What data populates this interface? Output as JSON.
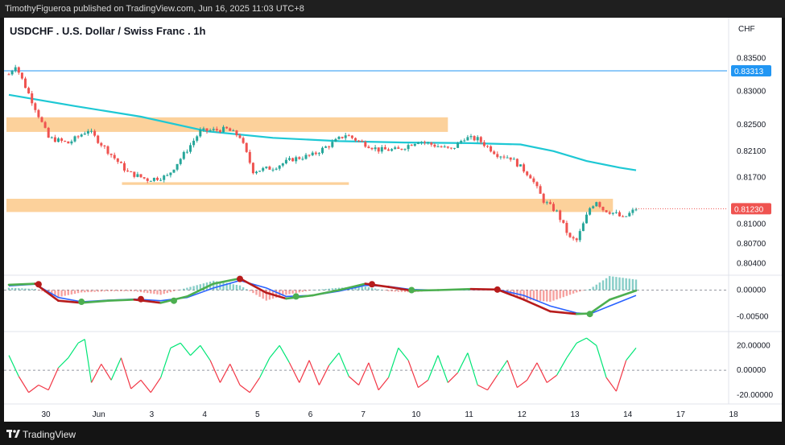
{
  "header": {
    "published_by": "TimothyFigueroa published on TradingView.com, Jun 16, 2025 11:03 UTC+8"
  },
  "chart": {
    "title": "USDCHF . U.S. Dollar / Swiss Franc . 1h",
    "currency": "CHF"
  },
  "footer": {
    "brand": "TradingView"
  },
  "colors": {
    "bull": "#26a69a",
    "bear": "#ef5350",
    "ma": "#1ec8d4",
    "zone": "#fbc98a",
    "hline": "#2196f3",
    "green": "#4caf50",
    "red": "#b71c1c",
    "blue": "#2962ff",
    "rsi_up": "#00e676",
    "rsi_down": "#f23645"
  },
  "chart_data": [
    {
      "type": "candlestick",
      "title": "USDCHF . U.S. Dollar / Swiss Franc . 1h",
      "x_ticks": [
        "30",
        "Jun",
        "3",
        "4",
        "5",
        "6",
        "7",
        "10",
        "11",
        "12",
        "13",
        "14",
        "17",
        "18"
      ],
      "y_ticks": [
        "0.83500",
        "0.83000",
        "0.82500",
        "0.82100",
        "0.81700",
        "0.81230",
        "0.81000",
        "0.80700",
        "0.80400"
      ],
      "ylim": [
        0.8025,
        0.8375
      ],
      "current_price_label": "0.81230",
      "horizontal_line_label": "0.83313",
      "horizontal_line": 0.83313,
      "zones": [
        {
          "from_bar": 0,
          "to_bar": 133,
          "low": 0.8239,
          "high": 0.8261
        },
        {
          "from_bar": 35,
          "to_bar": 103,
          "low": 0.8159,
          "high": 0.8163
        },
        {
          "from_bar": 0,
          "to_bar": 183,
          "low": 0.8118,
          "high": 0.8138
        }
      ],
      "key_closes": [
        {
          "bar": 0,
          "close": 0.8326
        },
        {
          "bar": 2,
          "close": 0.834
        },
        {
          "bar": 8,
          "close": 0.8275
        },
        {
          "bar": 12,
          "close": 0.823
        },
        {
          "bar": 18,
          "close": 0.8222
        },
        {
          "bar": 24,
          "close": 0.8242
        },
        {
          "bar": 30,
          "close": 0.821
        },
        {
          "bar": 36,
          "close": 0.8178
        },
        {
          "bar": 42,
          "close": 0.8167
        },
        {
          "bar": 48,
          "close": 0.8172
        },
        {
          "bar": 54,
          "close": 0.8212
        },
        {
          "bar": 58,
          "close": 0.824
        },
        {
          "bar": 66,
          "close": 0.8243
        },
        {
          "bar": 70,
          "close": 0.8232
        },
        {
          "bar": 74,
          "close": 0.818
        },
        {
          "bar": 80,
          "close": 0.8185
        },
        {
          "bar": 86,
          "close": 0.8198
        },
        {
          "bar": 92,
          "close": 0.8204
        },
        {
          "bar": 98,
          "close": 0.8222
        },
        {
          "bar": 102,
          "close": 0.8235
        },
        {
          "bar": 106,
          "close": 0.8225
        },
        {
          "bar": 112,
          "close": 0.8212
        },
        {
          "bar": 118,
          "close": 0.8212
        },
        {
          "bar": 124,
          "close": 0.8226
        },
        {
          "bar": 128,
          "close": 0.822
        },
        {
          "bar": 134,
          "close": 0.8212
        },
        {
          "bar": 138,
          "close": 0.823
        },
        {
          "bar": 142,
          "close": 0.8228
        },
        {
          "bar": 148,
          "close": 0.8205
        },
        {
          "bar": 152,
          "close": 0.82
        },
        {
          "bar": 158,
          "close": 0.8172
        },
        {
          "bar": 162,
          "close": 0.8135
        },
        {
          "bar": 166,
          "close": 0.8118
        },
        {
          "bar": 170,
          "close": 0.8078
        },
        {
          "bar": 172,
          "close": 0.8075
        },
        {
          "bar": 176,
          "close": 0.8124
        },
        {
          "bar": 178,
          "close": 0.8135
        },
        {
          "bar": 180,
          "close": 0.8122
        },
        {
          "bar": 184,
          "close": 0.8115
        },
        {
          "bar": 186,
          "close": 0.8108
        },
        {
          "bar": 190,
          "close": 0.8123
        }
      ],
      "moving_average": [
        {
          "bar": 0,
          "value": 0.8295
        },
        {
          "bar": 20,
          "value": 0.8278
        },
        {
          "bar": 40,
          "value": 0.8262
        },
        {
          "bar": 60,
          "value": 0.824
        },
        {
          "bar": 80,
          "value": 0.823
        },
        {
          "bar": 100,
          "value": 0.8225
        },
        {
          "bar": 120,
          "value": 0.8223
        },
        {
          "bar": 140,
          "value": 0.8222
        },
        {
          "bar": 155,
          "value": 0.822
        },
        {
          "bar": 165,
          "value": 0.821
        },
        {
          "bar": 175,
          "value": 0.8195
        },
        {
          "bar": 185,
          "value": 0.8185
        },
        {
          "bar": 190,
          "value": 0.8181
        }
      ]
    },
    {
      "type": "line",
      "name": "oscillator",
      "y_ticks": [
        "0.00000",
        "-0.00500"
      ],
      "ylim": [
        -0.0075,
        0.0025
      ],
      "series": [
        {
          "name": "fast",
          "points": [
            {
              "bar": 0,
              "value": 0.001
            },
            {
              "bar": 8,
              "value": 0.0012
            },
            {
              "bar": 15,
              "value": -0.002
            },
            {
              "bar": 22,
              "value": -0.0024
            },
            {
              "bar": 30,
              "value": -0.002
            },
            {
              "bar": 38,
              "value": -0.0018
            },
            {
              "bar": 46,
              "value": -0.0024
            },
            {
              "bar": 54,
              "value": -0.0012
            },
            {
              "bar": 62,
              "value": 0.0012
            },
            {
              "bar": 70,
              "value": 0.0022
            },
            {
              "bar": 78,
              "value": -0.0005
            },
            {
              "bar": 84,
              "value": -0.0016
            },
            {
              "bar": 92,
              "value": -0.001
            },
            {
              "bar": 100,
              "value": 0.0
            },
            {
              "bar": 108,
              "value": 0.0012
            },
            {
              "bar": 115,
              "value": 0.0006
            },
            {
              "bar": 122,
              "value": -0.0001
            },
            {
              "bar": 130,
              "value": 0.0
            },
            {
              "bar": 140,
              "value": 0.0002
            },
            {
              "bar": 148,
              "value": 0.0001
            },
            {
              "bar": 156,
              "value": -0.0018
            },
            {
              "bar": 164,
              "value": -0.004
            },
            {
              "bar": 172,
              "value": -0.0045
            },
            {
              "bar": 176,
              "value": -0.0044
            },
            {
              "bar": 182,
              "value": -0.0018
            },
            {
              "bar": 190,
              "value": -0.0001
            }
          ]
        },
        {
          "name": "slow",
          "points": [
            {
              "bar": 0,
              "value": 0.0008
            },
            {
              "bar": 8,
              "value": 0.0011
            },
            {
              "bar": 15,
              "value": -0.0014
            },
            {
              "bar": 22,
              "value": -0.0022
            },
            {
              "bar": 30,
              "value": -0.0019
            },
            {
              "bar": 38,
              "value": -0.0017
            },
            {
              "bar": 46,
              "value": -0.002
            },
            {
              "bar": 54,
              "value": -0.0014
            },
            {
              "bar": 62,
              "value": 0.0004
            },
            {
              "bar": 70,
              "value": 0.0018
            },
            {
              "bar": 78,
              "value": 0.0004
            },
            {
              "bar": 84,
              "value": -0.0012
            },
            {
              "bar": 92,
              "value": -0.001
            },
            {
              "bar": 100,
              "value": -0.0002
            },
            {
              "bar": 108,
              "value": 0.0009
            },
            {
              "bar": 115,
              "value": 0.0007
            },
            {
              "bar": 122,
              "value": 0.0001
            },
            {
              "bar": 130,
              "value": 0.0
            },
            {
              "bar": 140,
              "value": 0.0001
            },
            {
              "bar": 148,
              "value": 0.0001
            },
            {
              "bar": 156,
              "value": -0.001
            },
            {
              "bar": 164,
              "value": -0.003
            },
            {
              "bar": 172,
              "value": -0.0043
            },
            {
              "bar": 176,
              "value": -0.0045
            },
            {
              "bar": 182,
              "value": -0.003
            },
            {
              "bar": 190,
              "value": -0.001
            }
          ]
        }
      ],
      "cross_markers": [
        {
          "bar": 9,
          "value": 0.0011,
          "kind": "bearish"
        },
        {
          "bar": 22,
          "value": -0.0022,
          "kind": "bullish"
        },
        {
          "bar": 40,
          "value": -0.0017,
          "kind": "bearish"
        },
        {
          "bar": 50,
          "value": -0.002,
          "kind": "bullish"
        },
        {
          "bar": 70,
          "value": 0.0021,
          "kind": "bearish"
        },
        {
          "bar": 87,
          "value": -0.0012,
          "kind": "bullish"
        },
        {
          "bar": 110,
          "value": 0.0011,
          "kind": "bearish"
        },
        {
          "bar": 122,
          "value": 0.0,
          "kind": "bullish"
        },
        {
          "bar": 148,
          "value": 0.0001,
          "kind": "bearish"
        },
        {
          "bar": 176,
          "value": -0.0045,
          "kind": "bullish"
        }
      ]
    },
    {
      "type": "line",
      "name": "oscillator2",
      "y_ticks": [
        "20.00000",
        "0.00000",
        "-20.00000"
      ],
      "ylim": [
        -26,
        30
      ],
      "points": [
        {
          "bar": 0,
          "value": 12
        },
        {
          "bar": 3,
          "value": -5
        },
        {
          "bar": 6,
          "value": -18
        },
        {
          "bar": 9,
          "value": -12
        },
        {
          "bar": 12,
          "value": -16
        },
        {
          "bar": 15,
          "value": 2
        },
        {
          "bar": 18,
          "value": 10
        },
        {
          "bar": 21,
          "value": 22
        },
        {
          "bar": 23,
          "value": 25
        },
        {
          "bar": 25,
          "value": -10
        },
        {
          "bar": 28,
          "value": 5
        },
        {
          "bar": 31,
          "value": -8
        },
        {
          "bar": 34,
          "value": 10
        },
        {
          "bar": 37,
          "value": -15
        },
        {
          "bar": 40,
          "value": -8
        },
        {
          "bar": 43,
          "value": -18
        },
        {
          "bar": 46,
          "value": -6
        },
        {
          "bar": 49,
          "value": 18
        },
        {
          "bar": 52,
          "value": 22
        },
        {
          "bar": 55,
          "value": 12
        },
        {
          "bar": 58,
          "value": 20
        },
        {
          "bar": 61,
          "value": 8
        },
        {
          "bar": 64,
          "value": -10
        },
        {
          "bar": 67,
          "value": 5
        },
        {
          "bar": 70,
          "value": -12
        },
        {
          "bar": 73,
          "value": -18
        },
        {
          "bar": 76,
          "value": -6
        },
        {
          "bar": 79,
          "value": 10
        },
        {
          "bar": 82,
          "value": 20
        },
        {
          "bar": 85,
          "value": 6
        },
        {
          "bar": 88,
          "value": -10
        },
        {
          "bar": 91,
          "value": 8
        },
        {
          "bar": 94,
          "value": -12
        },
        {
          "bar": 97,
          "value": 4
        },
        {
          "bar": 100,
          "value": 14
        },
        {
          "bar": 103,
          "value": -5
        },
        {
          "bar": 106,
          "value": -12
        },
        {
          "bar": 109,
          "value": 6
        },
        {
          "bar": 112,
          "value": -16
        },
        {
          "bar": 115,
          "value": -6
        },
        {
          "bar": 118,
          "value": 18
        },
        {
          "bar": 121,
          "value": 8
        },
        {
          "bar": 124,
          "value": -14
        },
        {
          "bar": 127,
          "value": -8
        },
        {
          "bar": 130,
          "value": 12
        },
        {
          "bar": 133,
          "value": -10
        },
        {
          "bar": 136,
          "value": -2
        },
        {
          "bar": 139,
          "value": 14
        },
        {
          "bar": 142,
          "value": -12
        },
        {
          "bar": 145,
          "value": -16
        },
        {
          "bar": 148,
          "value": -4
        },
        {
          "bar": 151,
          "value": 8
        },
        {
          "bar": 154,
          "value": -14
        },
        {
          "bar": 157,
          "value": -8
        },
        {
          "bar": 160,
          "value": 6
        },
        {
          "bar": 163,
          "value": -10
        },
        {
          "bar": 166,
          "value": -4
        },
        {
          "bar": 169,
          "value": 10
        },
        {
          "bar": 172,
          "value": 22
        },
        {
          "bar": 175,
          "value": 26
        },
        {
          "bar": 178,
          "value": 20
        },
        {
          "bar": 181,
          "value": -6
        },
        {
          "bar": 184,
          "value": -17
        },
        {
          "bar": 187,
          "value": 8
        },
        {
          "bar": 190,
          "value": 18
        }
      ]
    }
  ]
}
